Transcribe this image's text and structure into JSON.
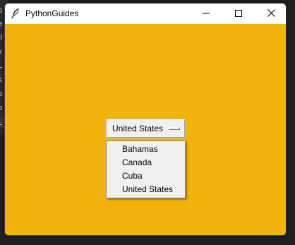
{
  "window": {
    "title": "PythonGuides",
    "app_icon": "feather-icon",
    "background_color": "#f0b30b",
    "controls": {
      "minimize_icon": "minimize-icon",
      "maximize_icon": "maximize-icon",
      "close_icon": "close-icon"
    }
  },
  "option_menu": {
    "selected": "United States",
    "options": [
      "Bahamas",
      "Canada",
      "Cuba",
      "United States"
    ]
  },
  "background_app": {
    "visible_chars": [
      "o",
      "e",
      "-i",
      "y",
      "L",
      "k",
      "o",
      "o",
      "L"
    ]
  }
}
